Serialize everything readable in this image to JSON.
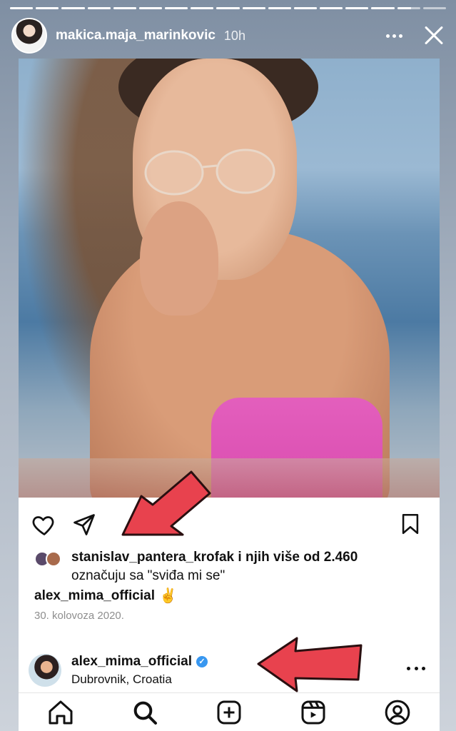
{
  "story": {
    "username": "makica.maja_marinkovic",
    "time_ago": "10h",
    "segments": [
      1,
      1,
      1,
      1,
      1,
      1,
      1,
      1,
      1,
      1,
      1,
      1,
      1,
      1,
      1,
      0.6,
      0
    ],
    "icons": {
      "more": "more-horizontal-icon",
      "close": "close-icon"
    }
  },
  "post": {
    "photo": "photo-woman-pink-bikini-boat",
    "actions": {
      "like": "heart-icon",
      "share": "paper-plane-icon",
      "save": "bookmark-icon"
    },
    "likes": {
      "liker": "stanislav_pantera_krofak",
      "rest": " i njih više od 2.460",
      "line2": "označuju sa \"sviđa mi se\""
    },
    "caption": {
      "username": "alex_mima_official",
      "emoji": "✌"
    },
    "date": "30. kolovoza 2020.",
    "author": {
      "username": "alex_mima_official",
      "verified": true,
      "location": "Dubrovnik, Croatia"
    }
  },
  "nav": [
    {
      "name": "home-icon"
    },
    {
      "name": "search-icon"
    },
    {
      "name": "add-post-icon"
    },
    {
      "name": "reels-icon"
    },
    {
      "name": "profile-icon"
    }
  ],
  "colors": {
    "annotation_arrow": "#e8424e",
    "verified": "#3897f0",
    "bikini": "#e35fbd"
  }
}
